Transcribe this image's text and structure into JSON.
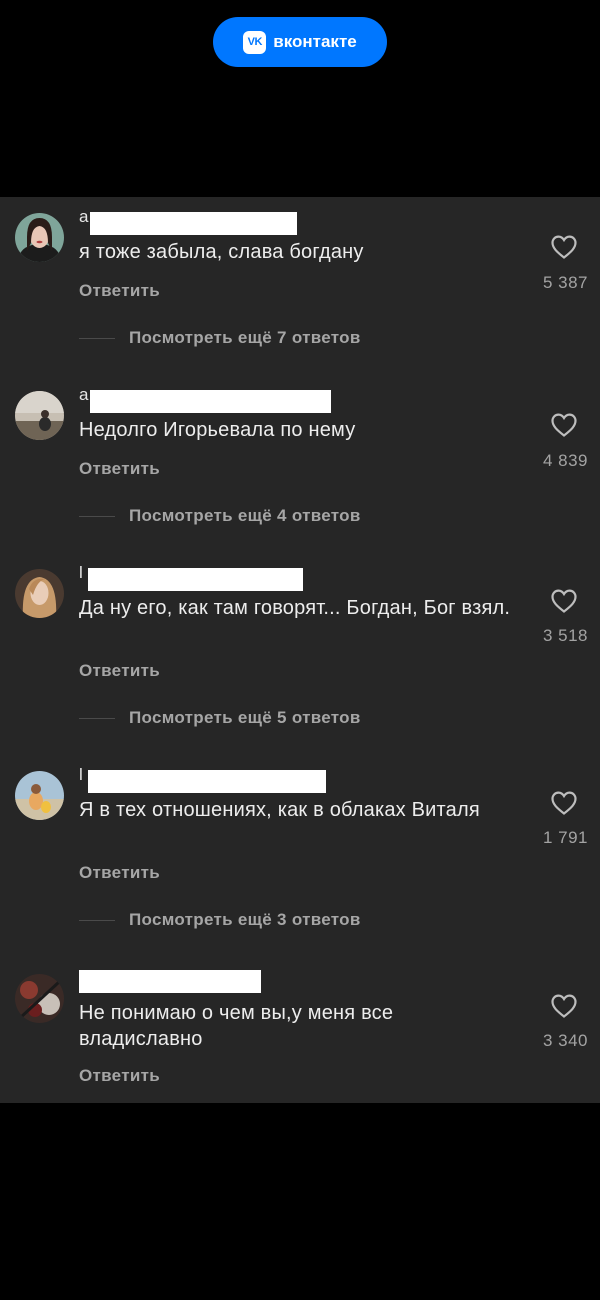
{
  "app": {
    "badge_label": "вконтакте",
    "logo_text": "VK",
    "brand_color": "#0077ff"
  },
  "comments": [
    {
      "name_initial": "a",
      "text": "я тоже забыла, слава богдану",
      "reply_label": "Ответить",
      "likes": "5 387",
      "more_replies": "Посмотреть ещё 7 ответов"
    },
    {
      "name_initial": "a",
      "text": "Недолго Игорьевала по нему",
      "reply_label": "Ответить",
      "likes": "4 839",
      "more_replies": "Посмотреть ещё 4 ответов"
    },
    {
      "name_initial": "l",
      "text": "Да ну его, как там говорят... Богдан, Бог взял.",
      "reply_label": "Ответить",
      "likes": "3 518",
      "more_replies": "Посмотреть ещё 5 ответов"
    },
    {
      "name_initial": "l",
      "text": "Я в тех отношениях, как в облаках Виталя",
      "reply_label": "Ответить",
      "likes": "1 791",
      "more_replies": "Посмотреть ещё 3 ответов"
    },
    {
      "name_initial": "",
      "text": "Не понимаю о чем вы,у меня все владиславно",
      "reply_label": "Ответить",
      "likes": "3 340"
    }
  ],
  "icons": {
    "like": "heart-outline-icon",
    "brand": "vk-logo-icon"
  }
}
